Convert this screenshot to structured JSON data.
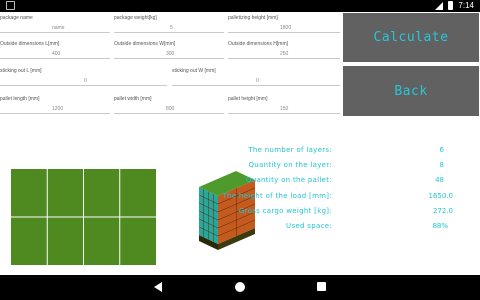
{
  "status": {
    "time": "7:14"
  },
  "fields": [
    {
      "label": "package name",
      "value": "name"
    },
    {
      "label": "package weight[kg]",
      "value": "5"
    },
    {
      "label": "palletizing height [mm]",
      "value": "1800"
    },
    {
      "label": "Outside dimensions L[mm]",
      "value": "400"
    },
    {
      "label": "Outside dimensions W[mm]",
      "value": "300"
    },
    {
      "label": "Outside dimensions H[mm]",
      "value": "250"
    },
    {
      "label": "sticking out L [mm]",
      "value": "0"
    },
    {
      "label": "sticking out W [mm]",
      "value": "0"
    },
    {
      "label": "pallet length [mm]",
      "value": "1200"
    },
    {
      "label": "pallet width [mm]",
      "value": "800"
    },
    {
      "label": "pallet height [mm]",
      "value": "150"
    }
  ],
  "buttons": {
    "calculate": "Calculate",
    "back": "Back"
  },
  "results": [
    {
      "label": "The number of layers:",
      "value": "6"
    },
    {
      "label": "Quantity on the layer:",
      "value": "8"
    },
    {
      "label": "Quantity on the pallet:",
      "value": "48"
    },
    {
      "label": "The height of the load [mm]:",
      "value": "1650.0"
    },
    {
      "label": "Gross cargo weight [kg]:",
      "value": "272.0"
    },
    {
      "label": "Used space:",
      "value": "88%"
    }
  ],
  "colors": {
    "accent": "#27c6d8",
    "button_bg": "#616161",
    "layout_green": "#4e8a1f",
    "box_front": "#c45a1e",
    "box_side": "#2aa79b",
    "box_top": "#4f9a2c",
    "pallet": "#3b3b0f"
  },
  "icons": {
    "status_left": "notification-square-icon",
    "signal": "signal-icon",
    "battery": "battery-icon",
    "nav_back": "nav-back-icon",
    "nav_home": "nav-home-icon",
    "nav_recents": "nav-recents-icon"
  }
}
